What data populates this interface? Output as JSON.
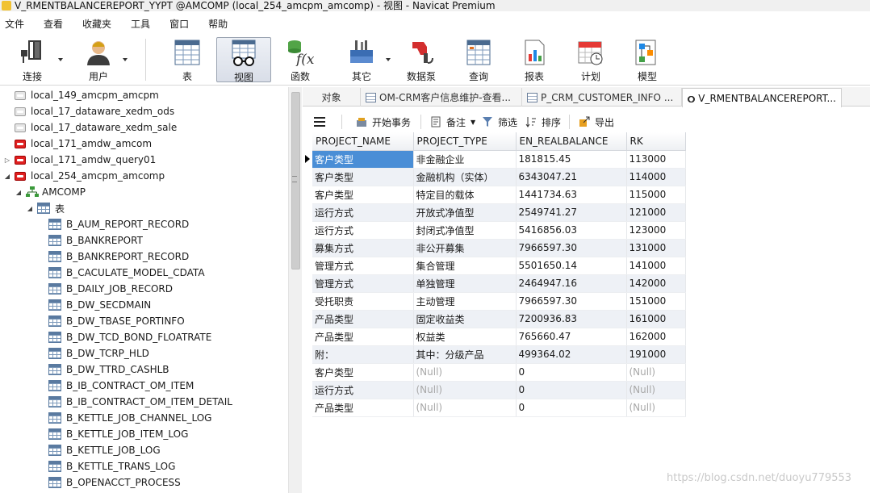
{
  "window": {
    "title": "V_RMENTBALANCEREPORT_YYPT @AMCOMP (local_254_amcpm_amcomp) - 视图 - Navicat Premium"
  },
  "menu": [
    "文件",
    "查看",
    "收藏夹",
    "工具",
    "窗口",
    "帮助"
  ],
  "toolbar": {
    "connect": "连接",
    "user": "用户",
    "table": "表",
    "view": "视图",
    "function": "函数",
    "other": "其它",
    "datapump": "数据泵",
    "query": "查询",
    "report": "报表",
    "schedule": "计划",
    "model": "模型"
  },
  "tree": {
    "connections": [
      {
        "label": "local_149_amcpm_amcpm",
        "color": "grey"
      },
      {
        "label": "local_17_dataware_xedm_ods",
        "color": "grey"
      },
      {
        "label": "local_17_dataware_xedm_sale",
        "color": "grey"
      },
      {
        "label": "local_171_amdw_amcom",
        "color": "red"
      },
      {
        "label": "local_171_amdw_query01",
        "color": "red"
      },
      {
        "label": "local_254_amcpm_amcomp",
        "color": "red"
      }
    ],
    "schema": "AMCOMP",
    "tables_label": "表",
    "tables": [
      "B_AUM_REPORT_RECORD",
      "B_BANKREPORT",
      "B_BANKREPORT_RECORD",
      "B_CACULATE_MODEL_CDATA",
      "B_DAILY_JOB_RECORD",
      "B_DW_SECDMAIN",
      "B_DW_TBASE_PORTINFO",
      "B_DW_TCD_BOND_FLOATRATE",
      "B_DW_TCRP_HLD",
      "B_DW_TTRD_CASHLB",
      "B_IB_CONTRACT_OM_ITEM",
      "B_IB_CONTRACT_OM_ITEM_DETAIL",
      "B_KETTLE_JOB_CHANNEL_LOG",
      "B_KETTLE_JOB_ITEM_LOG",
      "B_KETTLE_JOB_LOG",
      "B_KETTLE_TRANS_LOG",
      "B_OPENACCT_PROCESS"
    ]
  },
  "tabs": {
    "objects": "对象",
    "tab1": "OM-CRM客户信息维护-查看...",
    "tab2": "P_CRM_CUSTOMER_INFO ...",
    "tab3": "V_RMENTBALANCEREPORT..."
  },
  "objbar": {
    "begin_tx": "开始事务",
    "memo": "备注",
    "filter": "筛选",
    "sort": "排序",
    "export": "导出"
  },
  "grid": {
    "columns": [
      "PROJECT_NAME",
      "PROJECT_TYPE",
      "EN_REALBALANCE",
      "RK"
    ],
    "rows": [
      [
        "客户类型",
        "非金融企业",
        "181815.45",
        "113000"
      ],
      [
        "客户类型",
        "金融机构（实体）",
        "6343047.21",
        "114000"
      ],
      [
        "客户类型",
        "特定目的载体",
        "1441734.63",
        "115000"
      ],
      [
        "运行方式",
        "开放式净值型",
        "2549741.27",
        "121000"
      ],
      [
        "运行方式",
        "封闭式净值型",
        "5416856.03",
        "123000"
      ],
      [
        "募集方式",
        "非公开募集",
        "7966597.30",
        "131000"
      ],
      [
        "管理方式",
        "集合管理",
        "5501650.14",
        "141000"
      ],
      [
        "管理方式",
        "单独管理",
        "2464947.16",
        "142000"
      ],
      [
        "受托职责",
        "主动管理",
        "7966597.30",
        "151000"
      ],
      [
        "产品类型",
        "固定收益类",
        "7200936.83",
        "161000"
      ],
      [
        "产品类型",
        "权益类",
        "765660.47",
        "162000"
      ],
      [
        "附：",
        "其中：分级产品",
        "499364.02",
        "191000"
      ],
      [
        "客户类型",
        "(Null)",
        "0",
        "(Null)"
      ],
      [
        "运行方式",
        "(Null)",
        "0",
        "(Null)"
      ],
      [
        "产品类型",
        "(Null)",
        "0",
        "(Null)"
      ]
    ]
  },
  "watermark": "https://blog.csdn.net/duoyu779553"
}
